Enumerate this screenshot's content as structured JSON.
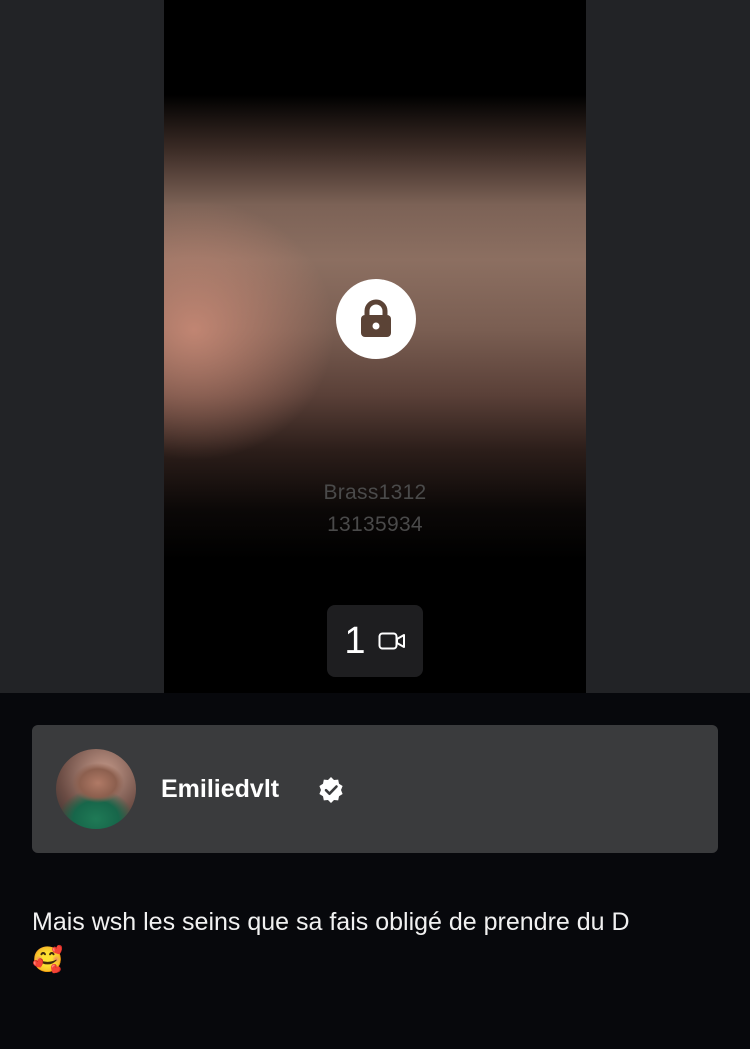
{
  "media": {
    "lock_icon": "lock-icon",
    "watermark_line1": "Brass1312",
    "watermark_line2": "13135934",
    "video_count": "1",
    "video_icon": "video-camera-icon"
  },
  "profile": {
    "username": "Emiliedvlt",
    "verified_icon": "verified-badge-icon",
    "avatar_icon": "avatar"
  },
  "post": {
    "caption_text": "Mais wsh les seins que sa fais obligé de prendre du D",
    "caption_emoji": "🥰"
  }
}
